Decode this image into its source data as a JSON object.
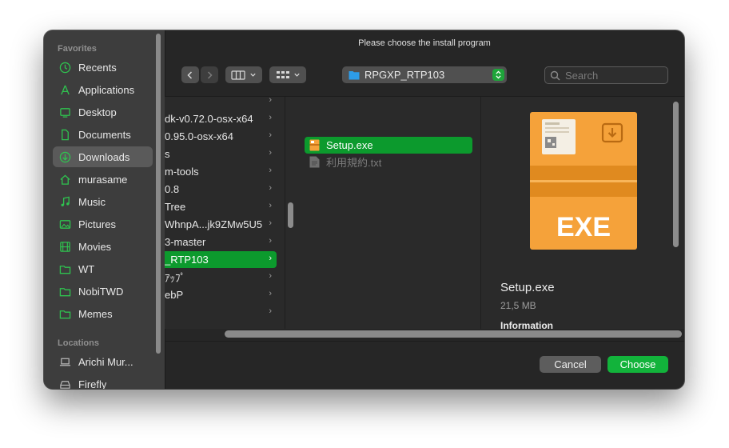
{
  "dialog": {
    "title": "Please choose the install program"
  },
  "sidebar": {
    "favorites_header": "Favorites",
    "favorites": [
      {
        "label": "Recents",
        "icon": "clock-icon"
      },
      {
        "label": "Applications",
        "icon": "applications-icon"
      },
      {
        "label": "Desktop",
        "icon": "desktop-icon"
      },
      {
        "label": "Documents",
        "icon": "document-icon"
      },
      {
        "label": "Downloads",
        "icon": "downloads-icon",
        "selected": true
      },
      {
        "label": "murasame",
        "icon": "home-icon"
      },
      {
        "label": "Music",
        "icon": "music-icon"
      },
      {
        "label": "Pictures",
        "icon": "pictures-icon"
      },
      {
        "label": "Movies",
        "icon": "movies-icon"
      },
      {
        "label": "WT",
        "icon": "folder-icon"
      },
      {
        "label": "NobiTWD",
        "icon": "folder-icon"
      },
      {
        "label": "Memes",
        "icon": "folder-icon"
      }
    ],
    "locations_header": "Locations",
    "locations": [
      {
        "label": "Arichi Mur...",
        "icon": "laptop-icon"
      },
      {
        "label": "Firefly",
        "icon": "drive-icon"
      }
    ]
  },
  "toolbar": {
    "back_icon": "chevron-left-icon",
    "forward_icon": "chevron-right-icon",
    "view_icon": "columns-view-icon",
    "group_icon": "grid-view-icon",
    "path_folder": "RPGXP_RTP103",
    "search_placeholder": "Search"
  },
  "columns": {
    "downloads_items": [
      {
        "label": "",
        "has_children": true
      },
      {
        "label": "dk-v0.72.0-osx-x64",
        "has_children": true
      },
      {
        "label": "0.95.0-osx-x64",
        "has_children": true
      },
      {
        "label": "s",
        "has_children": true
      },
      {
        "label": "m-tools",
        "has_children": true
      },
      {
        "label": "0.8",
        "has_children": true
      },
      {
        "label": "Tree",
        "has_children": true
      },
      {
        "label": "WhnpA...jk9ZMw5U5",
        "has_children": true
      },
      {
        "label": "3-master",
        "has_children": true
      },
      {
        "label": "_RTP103",
        "has_children": true,
        "selected": true
      },
      {
        "label": "ｱｯﾌﾟ",
        "has_children": true
      },
      {
        "label": "ebP",
        "has_children": true
      },
      {
        "label": "",
        "has_children": true
      }
    ],
    "folder_items": [
      {
        "label": "Setup.exe",
        "icon": "exe-file-icon",
        "selected": true
      },
      {
        "label": "利用規約.txt",
        "icon": "text-file-icon",
        "dimmed": true
      }
    ]
  },
  "preview": {
    "icon_text": "EXE",
    "name": "Setup.exe",
    "size": "21,5 MB",
    "info_header": "Information"
  },
  "buttons": {
    "cancel": "Cancel",
    "choose": "Choose"
  },
  "colors": {
    "accent": "#12b33b",
    "selection": "#0c9a2d",
    "exe_orange": "#f5a23a"
  }
}
